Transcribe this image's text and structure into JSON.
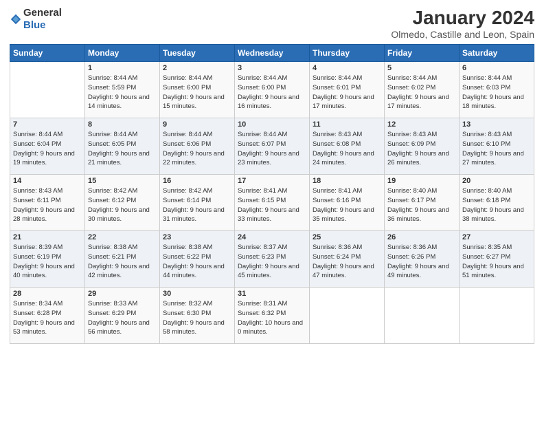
{
  "header": {
    "logo_general": "General",
    "logo_blue": "Blue",
    "month": "January 2024",
    "location": "Olmedo, Castille and Leon, Spain"
  },
  "days_of_week": [
    "Sunday",
    "Monday",
    "Tuesday",
    "Wednesday",
    "Thursday",
    "Friday",
    "Saturday"
  ],
  "weeks": [
    [
      {
        "day": "",
        "sunrise": "",
        "sunset": "",
        "daylight": ""
      },
      {
        "day": "1",
        "sunrise": "Sunrise: 8:44 AM",
        "sunset": "Sunset: 5:59 PM",
        "daylight": "Daylight: 9 hours and 14 minutes."
      },
      {
        "day": "2",
        "sunrise": "Sunrise: 8:44 AM",
        "sunset": "Sunset: 6:00 PM",
        "daylight": "Daylight: 9 hours and 15 minutes."
      },
      {
        "day": "3",
        "sunrise": "Sunrise: 8:44 AM",
        "sunset": "Sunset: 6:00 PM",
        "daylight": "Daylight: 9 hours and 16 minutes."
      },
      {
        "day": "4",
        "sunrise": "Sunrise: 8:44 AM",
        "sunset": "Sunset: 6:01 PM",
        "daylight": "Daylight: 9 hours and 17 minutes."
      },
      {
        "day": "5",
        "sunrise": "Sunrise: 8:44 AM",
        "sunset": "Sunset: 6:02 PM",
        "daylight": "Daylight: 9 hours and 17 minutes."
      },
      {
        "day": "6",
        "sunrise": "Sunrise: 8:44 AM",
        "sunset": "Sunset: 6:03 PM",
        "daylight": "Daylight: 9 hours and 18 minutes."
      }
    ],
    [
      {
        "day": "7",
        "sunrise": "Sunrise: 8:44 AM",
        "sunset": "Sunset: 6:04 PM",
        "daylight": "Daylight: 9 hours and 19 minutes."
      },
      {
        "day": "8",
        "sunrise": "Sunrise: 8:44 AM",
        "sunset": "Sunset: 6:05 PM",
        "daylight": "Daylight: 9 hours and 21 minutes."
      },
      {
        "day": "9",
        "sunrise": "Sunrise: 8:44 AM",
        "sunset": "Sunset: 6:06 PM",
        "daylight": "Daylight: 9 hours and 22 minutes."
      },
      {
        "day": "10",
        "sunrise": "Sunrise: 8:44 AM",
        "sunset": "Sunset: 6:07 PM",
        "daylight": "Daylight: 9 hours and 23 minutes."
      },
      {
        "day": "11",
        "sunrise": "Sunrise: 8:43 AM",
        "sunset": "Sunset: 6:08 PM",
        "daylight": "Daylight: 9 hours and 24 minutes."
      },
      {
        "day": "12",
        "sunrise": "Sunrise: 8:43 AM",
        "sunset": "Sunset: 6:09 PM",
        "daylight": "Daylight: 9 hours and 26 minutes."
      },
      {
        "day": "13",
        "sunrise": "Sunrise: 8:43 AM",
        "sunset": "Sunset: 6:10 PM",
        "daylight": "Daylight: 9 hours and 27 minutes."
      }
    ],
    [
      {
        "day": "14",
        "sunrise": "Sunrise: 8:43 AM",
        "sunset": "Sunset: 6:11 PM",
        "daylight": "Daylight: 9 hours and 28 minutes."
      },
      {
        "day": "15",
        "sunrise": "Sunrise: 8:42 AM",
        "sunset": "Sunset: 6:12 PM",
        "daylight": "Daylight: 9 hours and 30 minutes."
      },
      {
        "day": "16",
        "sunrise": "Sunrise: 8:42 AM",
        "sunset": "Sunset: 6:14 PM",
        "daylight": "Daylight: 9 hours and 31 minutes."
      },
      {
        "day": "17",
        "sunrise": "Sunrise: 8:41 AM",
        "sunset": "Sunset: 6:15 PM",
        "daylight": "Daylight: 9 hours and 33 minutes."
      },
      {
        "day": "18",
        "sunrise": "Sunrise: 8:41 AM",
        "sunset": "Sunset: 6:16 PM",
        "daylight": "Daylight: 9 hours and 35 minutes."
      },
      {
        "day": "19",
        "sunrise": "Sunrise: 8:40 AM",
        "sunset": "Sunset: 6:17 PM",
        "daylight": "Daylight: 9 hours and 36 minutes."
      },
      {
        "day": "20",
        "sunrise": "Sunrise: 8:40 AM",
        "sunset": "Sunset: 6:18 PM",
        "daylight": "Daylight: 9 hours and 38 minutes."
      }
    ],
    [
      {
        "day": "21",
        "sunrise": "Sunrise: 8:39 AM",
        "sunset": "Sunset: 6:19 PM",
        "daylight": "Daylight: 9 hours and 40 minutes."
      },
      {
        "day": "22",
        "sunrise": "Sunrise: 8:38 AM",
        "sunset": "Sunset: 6:21 PM",
        "daylight": "Daylight: 9 hours and 42 minutes."
      },
      {
        "day": "23",
        "sunrise": "Sunrise: 8:38 AM",
        "sunset": "Sunset: 6:22 PM",
        "daylight": "Daylight: 9 hours and 44 minutes."
      },
      {
        "day": "24",
        "sunrise": "Sunrise: 8:37 AM",
        "sunset": "Sunset: 6:23 PM",
        "daylight": "Daylight: 9 hours and 45 minutes."
      },
      {
        "day": "25",
        "sunrise": "Sunrise: 8:36 AM",
        "sunset": "Sunset: 6:24 PM",
        "daylight": "Daylight: 9 hours and 47 minutes."
      },
      {
        "day": "26",
        "sunrise": "Sunrise: 8:36 AM",
        "sunset": "Sunset: 6:26 PM",
        "daylight": "Daylight: 9 hours and 49 minutes."
      },
      {
        "day": "27",
        "sunrise": "Sunrise: 8:35 AM",
        "sunset": "Sunset: 6:27 PM",
        "daylight": "Daylight: 9 hours and 51 minutes."
      }
    ],
    [
      {
        "day": "28",
        "sunrise": "Sunrise: 8:34 AM",
        "sunset": "Sunset: 6:28 PM",
        "daylight": "Daylight: 9 hours and 53 minutes."
      },
      {
        "day": "29",
        "sunrise": "Sunrise: 8:33 AM",
        "sunset": "Sunset: 6:29 PM",
        "daylight": "Daylight: 9 hours and 56 minutes."
      },
      {
        "day": "30",
        "sunrise": "Sunrise: 8:32 AM",
        "sunset": "Sunset: 6:30 PM",
        "daylight": "Daylight: 9 hours and 58 minutes."
      },
      {
        "day": "31",
        "sunrise": "Sunrise: 8:31 AM",
        "sunset": "Sunset: 6:32 PM",
        "daylight": "Daylight: 10 hours and 0 minutes."
      },
      {
        "day": "",
        "sunrise": "",
        "sunset": "",
        "daylight": ""
      },
      {
        "day": "",
        "sunrise": "",
        "sunset": "",
        "daylight": ""
      },
      {
        "day": "",
        "sunrise": "",
        "sunset": "",
        "daylight": ""
      }
    ]
  ]
}
